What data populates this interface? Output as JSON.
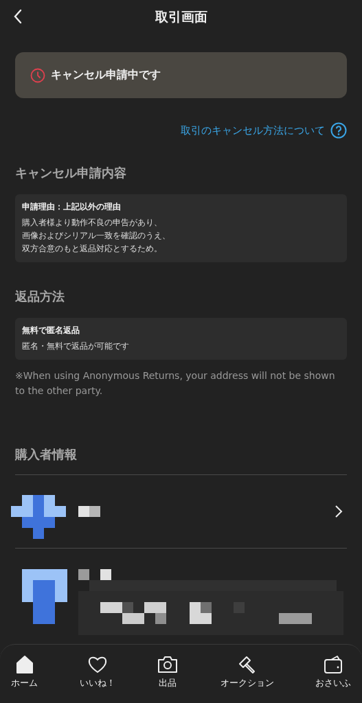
{
  "header": {
    "title": "取引画面"
  },
  "status_banner": {
    "text": "キャンセル申請中です"
  },
  "help_link": {
    "text": "取引のキャンセル方法について"
  },
  "cancel_request": {
    "heading": "キャンセル申請内容",
    "card_title": "申請理由：上記以外の理由",
    "lines": [
      "購入者様より動作不良の申告があり、",
      "画像およびシリアル一致を確認のうえ、",
      "双方合意のもと返品対応とするため。"
    ]
  },
  "return_method": {
    "heading": "返品方法",
    "card_title": "無料で匿名返品",
    "lines": [
      "匿名・無料で返品が可能です"
    ]
  },
  "note": "※When using Anonymous Returns, your address will not be shown to the other party.",
  "buyer": {
    "heading": "購入者情報"
  },
  "nav": [
    {
      "label": "ホーム",
      "kind": "home",
      "selected": true
    },
    {
      "label": "いいね！",
      "kind": "heart",
      "selected": false
    },
    {
      "label": "出品",
      "kind": "camera",
      "selected": false
    },
    {
      "label": "オークション",
      "kind": "gavel",
      "selected": false
    },
    {
      "label": "おさいふ",
      "kind": "wallet",
      "selected": false
    }
  ]
}
